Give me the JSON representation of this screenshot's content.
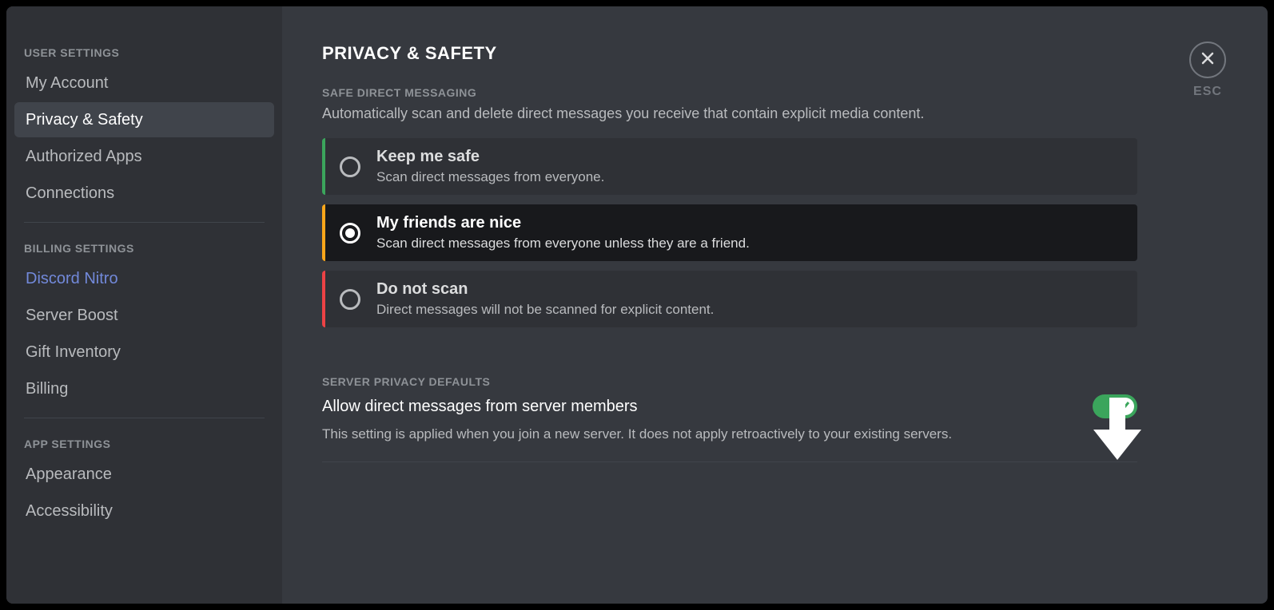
{
  "sidebar": {
    "categories": [
      {
        "label": "User Settings",
        "items": [
          {
            "label": "My Account",
            "selected": false
          },
          {
            "label": "Privacy & Safety",
            "selected": true
          },
          {
            "label": "Authorized Apps",
            "selected": false
          },
          {
            "label": "Connections",
            "selected": false
          }
        ]
      },
      {
        "label": "Billing Settings",
        "items": [
          {
            "label": "Discord Nitro",
            "selected": false,
            "nitro": true
          },
          {
            "label": "Server Boost",
            "selected": false
          },
          {
            "label": "Gift Inventory",
            "selected": false
          },
          {
            "label": "Billing",
            "selected": false
          }
        ]
      },
      {
        "label": "App Settings",
        "items": [
          {
            "label": "Appearance",
            "selected": false
          },
          {
            "label": "Accessibility",
            "selected": false
          }
        ]
      }
    ]
  },
  "close_label": "ESC",
  "page_title": "Privacy & Safety",
  "safe_dm": {
    "header": "Safe Direct Messaging",
    "description": "Automatically scan and delete direct messages you receive that contain explicit media content.",
    "options": [
      {
        "title": "Keep me safe",
        "desc": "Scan direct messages from everyone.",
        "color": "green",
        "selected": false
      },
      {
        "title": "My friends are nice",
        "desc": "Scan direct messages from everyone unless they are a friend.",
        "color": "yellow",
        "selected": true
      },
      {
        "title": "Do not scan",
        "desc": "Direct messages will not be scanned for explicit content.",
        "color": "red",
        "selected": false
      }
    ]
  },
  "server_privacy": {
    "header": "Server Privacy Defaults",
    "toggle_title": "Allow direct messages from server members",
    "toggle_desc": "This setting is applied when you join a new server. It does not apply retroactively to your existing servers.",
    "toggle_on": true
  }
}
